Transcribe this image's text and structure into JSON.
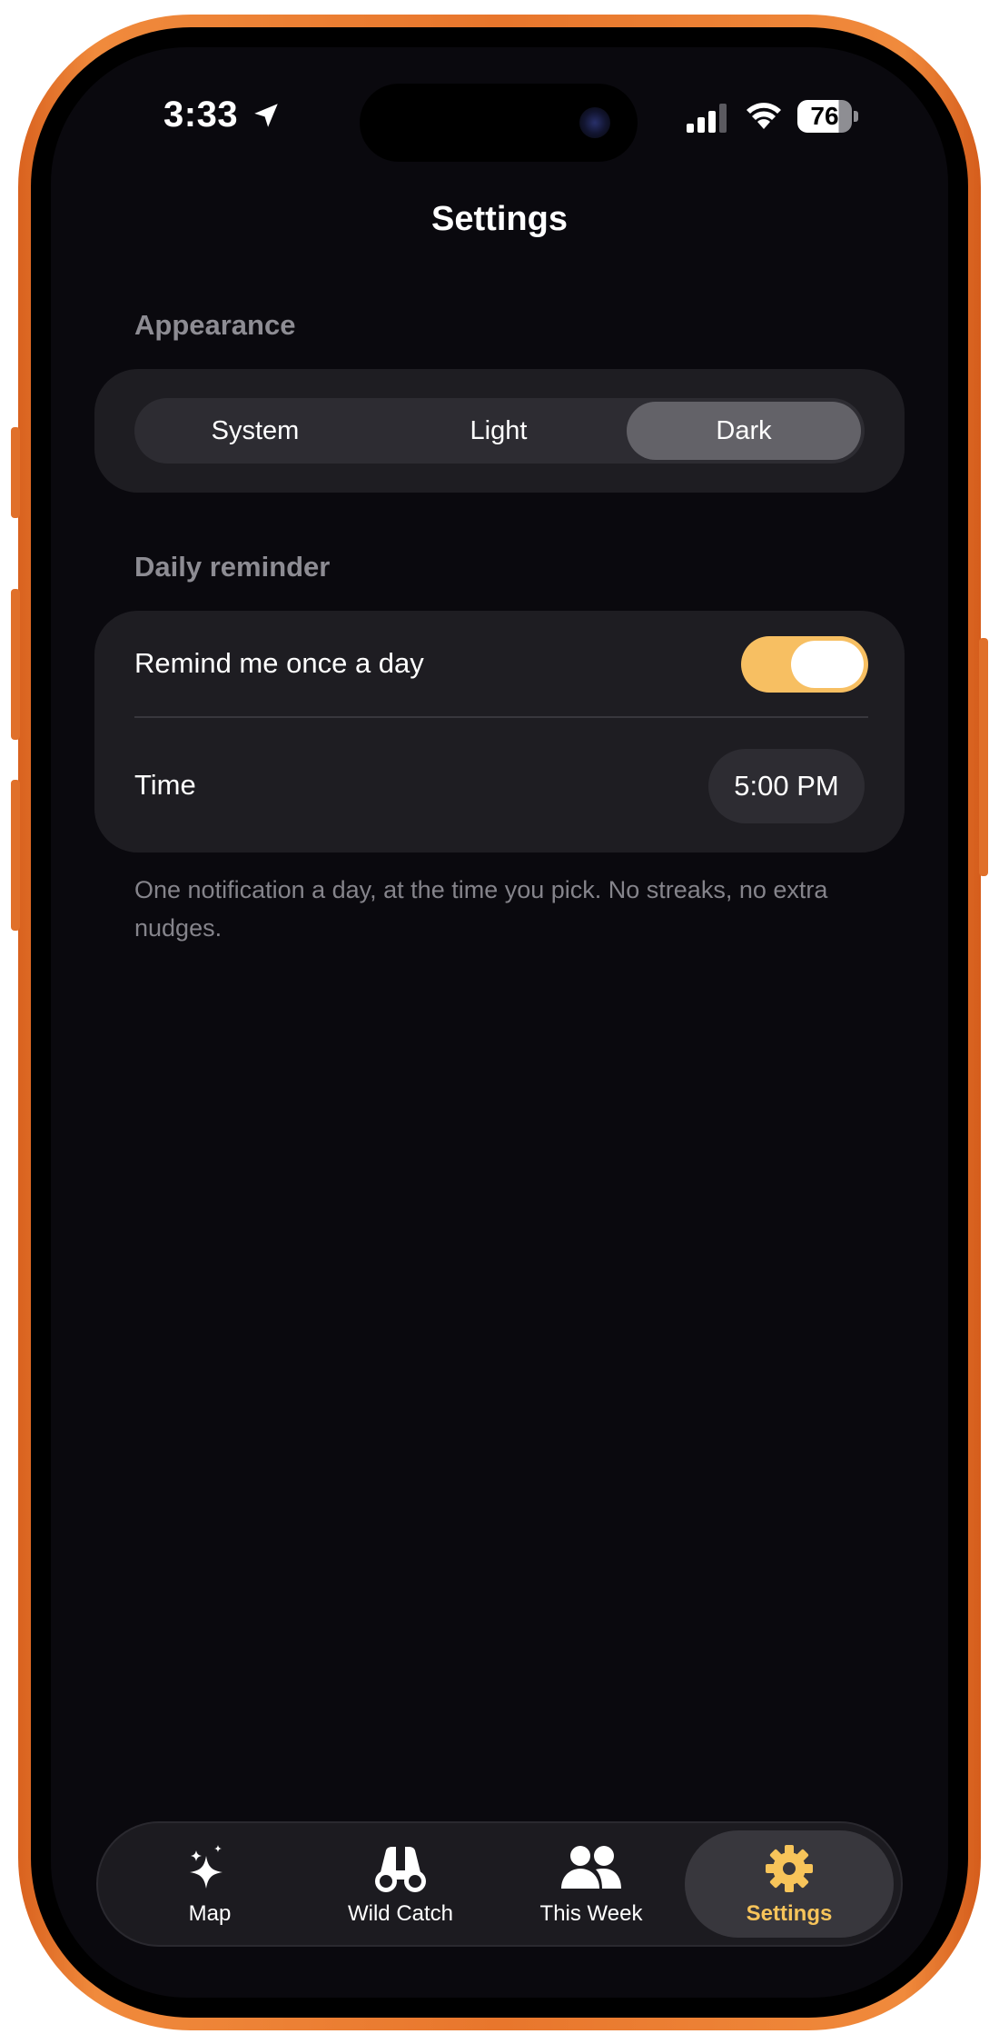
{
  "status": {
    "time": "3:33",
    "battery": "76"
  },
  "header": {
    "title": "Settings"
  },
  "appearance": {
    "label": "Appearance",
    "options": [
      "System",
      "Light",
      "Dark"
    ],
    "selected": "Dark"
  },
  "reminder": {
    "label": "Daily reminder",
    "toggle_label": "Remind me once a day",
    "enabled": true,
    "time_label": "Time",
    "time_value": "5:00 PM",
    "footnote": "One notification a day, at the time you pick. No streaks, no extra nudges."
  },
  "tabs": [
    {
      "label": "Map",
      "icon": "sparkles-icon"
    },
    {
      "label": "Wild Catch",
      "icon": "binoculars-icon"
    },
    {
      "label": "This Week",
      "icon": "people-icon"
    },
    {
      "label": "Settings",
      "icon": "gear-icon"
    }
  ],
  "colors": {
    "accent": "#f7c45a",
    "toggle_on": "#f7bf62",
    "background": "#0a090e",
    "frame": "#e8762c"
  }
}
